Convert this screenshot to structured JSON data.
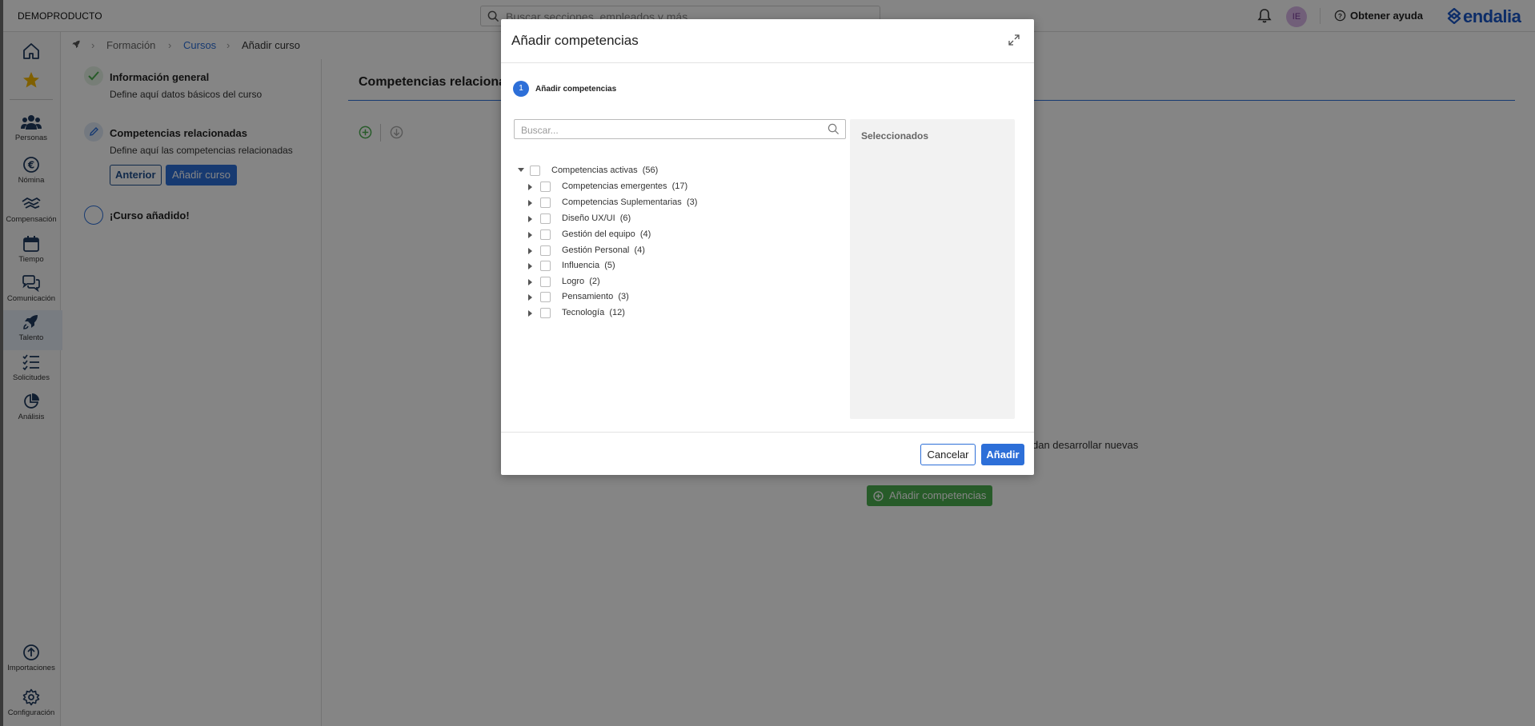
{
  "topbar": {
    "brand": "DEMOPRODUCTO",
    "search_placeholder": "Buscar secciones, empleados y más",
    "avatar_initials": "IE",
    "help_label": "Obtener ayuda",
    "logo_text": "endalia"
  },
  "sidenav": {
    "items": [
      {
        "label": "",
        "icon": "home-icon"
      },
      {
        "label": "",
        "icon": "star-icon"
      },
      {
        "label": "Personas",
        "icon": "people-icon"
      },
      {
        "label": "Nómina",
        "icon": "euro-icon"
      },
      {
        "label": "Compensación",
        "icon": "handshake-icon"
      },
      {
        "label": "Tiempo",
        "icon": "calendar-icon"
      },
      {
        "label": "Comunicación",
        "icon": "chat-icon"
      },
      {
        "label": "Talento",
        "icon": "rocket-icon"
      },
      {
        "label": "Solicitudes",
        "icon": "checklist-icon"
      },
      {
        "label": "Análisis",
        "icon": "pie-chart-icon"
      },
      {
        "label": "Importaciones",
        "icon": "upload-icon"
      },
      {
        "label": "Configuración",
        "icon": "gear-icon"
      }
    ]
  },
  "breadcrumb": {
    "items": [
      "Formación",
      "Cursos",
      "Añadir curso"
    ]
  },
  "steps": {
    "step1": {
      "title": "Información general",
      "desc": "Define aquí datos básicos del curso"
    },
    "step2": {
      "title": "Competencias relacionadas",
      "desc": "Define aquí las competencias relacionadas",
      "prev_label": "Anterior",
      "next_label": "Añadir curso"
    },
    "step3": {
      "title": "¡Curso añadido!"
    }
  },
  "main": {
    "title": "Competencias relaciona",
    "body_text": "dan desarrollar nuevas",
    "add_button": "Añadir competencias"
  },
  "modal": {
    "title": "Añadir competencias",
    "wizard_step_number": "1",
    "wizard_step_label": "Añadir competencias",
    "search_placeholder": "Buscar...",
    "selected_title": "Seleccionados",
    "tree_root": {
      "label": "Competencias activas",
      "count": "(56)"
    },
    "tree_children": [
      {
        "label": "Competencias emergentes",
        "count": "(17)"
      },
      {
        "label": "Competencias Suplementarias",
        "count": "(3)"
      },
      {
        "label": "Diseño UX/UI",
        "count": "(6)"
      },
      {
        "label": "Gestión del equipo",
        "count": "(4)"
      },
      {
        "label": "Gestión Personal",
        "count": "(4)"
      },
      {
        "label": "Influencia",
        "count": "(5)"
      },
      {
        "label": "Logro",
        "count": "(2)"
      },
      {
        "label": "Pensamiento",
        "count": "(3)"
      },
      {
        "label": "Tecnología",
        "count": "(12)"
      }
    ],
    "cancel_label": "Cancelar",
    "add_label": "Añadir"
  },
  "colors": {
    "primary": "#2d6fd8",
    "success": "#4caf50",
    "logo": "#1a56c7"
  }
}
